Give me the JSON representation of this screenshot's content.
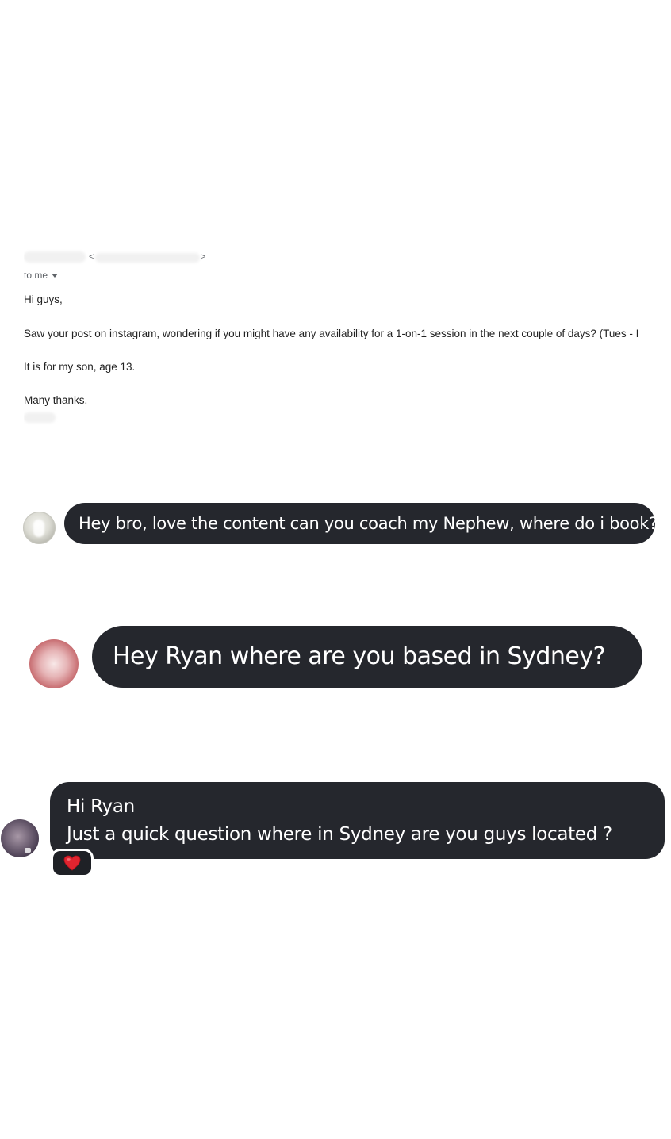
{
  "email": {
    "sender_bracket_open": "<",
    "sender_bracket_close": ">",
    "recipient_label": "to me",
    "greeting": "Hi guys,",
    "body_line": "Saw your post on instagram, wondering if you might have any availability for a 1-on-1 session in the next couple of days? (Tues - I",
    "context_line": "It is for my son, age 13.",
    "signoff": "Many thanks,"
  },
  "messages": [
    {
      "text": "Hey bro, love the content can you coach my Nephew, where do i book?"
    },
    {
      "text": "Hey Ryan where are you based in Sydney?"
    },
    {
      "lines": [
        "Hi Ryan",
        "Just a quick question where in Sydney are you guys located ?"
      ],
      "reaction": "heart-emoji"
    }
  ],
  "colors": {
    "bubble_background": "#25272d",
    "bubble_text": "#ffffff",
    "reaction_heart": "#e0242f",
    "email_text": "#222222",
    "email_meta_text": "#5f6368"
  }
}
